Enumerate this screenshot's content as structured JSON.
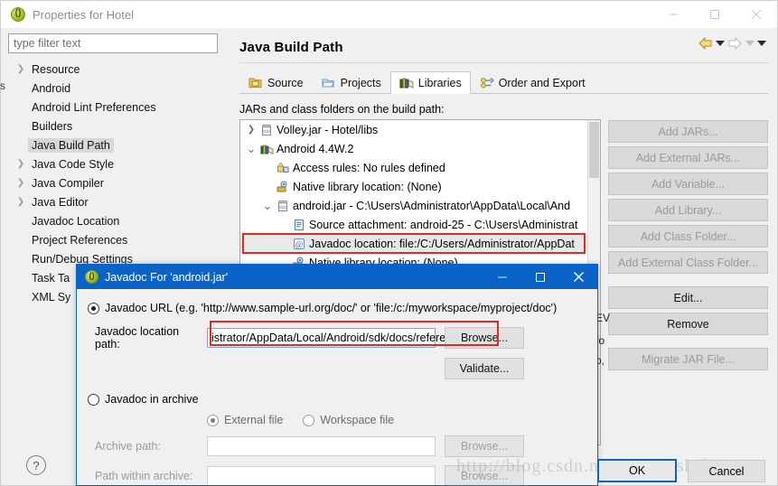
{
  "window": {
    "title": "Properties for Hotel",
    "icon": "eclipse-icon",
    "controls": {
      "minimize": "–",
      "maximize": "□",
      "close": "✕"
    }
  },
  "left_pane": {
    "filter": {
      "placeholder": "type filter text",
      "value": ""
    },
    "tree": [
      {
        "label": "Resource",
        "expandable": true,
        "selected": false
      },
      {
        "label": "Android",
        "expandable": false,
        "selected": false
      },
      {
        "label": "Android Lint Preferences",
        "expandable": false,
        "selected": false
      },
      {
        "label": "Builders",
        "expandable": false,
        "selected": false
      },
      {
        "label": "Java Build Path",
        "expandable": false,
        "selected": true
      },
      {
        "label": "Java Code Style",
        "expandable": true,
        "selected": false
      },
      {
        "label": "Java Compiler",
        "expandable": true,
        "selected": false
      },
      {
        "label": "Java Editor",
        "expandable": true,
        "selected": false
      },
      {
        "label": "Javadoc Location",
        "expandable": false,
        "selected": false
      },
      {
        "label": "Project References",
        "expandable": false,
        "selected": false
      },
      {
        "label": "Run/Debug Settings",
        "expandable": false,
        "selected": false
      },
      {
        "label": "Task Ta",
        "expandable": false,
        "selected": false
      },
      {
        "label": "XML Sy",
        "expandable": false,
        "selected": false
      }
    ],
    "edge_letter": "s"
  },
  "page": {
    "title": "Java Build Path",
    "nav": {
      "back": "back-arrow",
      "back_menu": "caret",
      "forward": "forward-arrow",
      "forward_menu": "caret",
      "view_menu": "caret"
    },
    "tabs": [
      {
        "label": "Source",
        "icon": "source-folder-icon",
        "active": false
      },
      {
        "label": "Projects",
        "icon": "projects-folder-icon",
        "active": false
      },
      {
        "label": "Libraries",
        "icon": "libraries-books-icon",
        "active": true
      },
      {
        "label": "Order and Export",
        "icon": "order-export-icon",
        "active": false
      }
    ],
    "jars_label": "JARs and class folders on the build path:",
    "tree": [
      {
        "label": "Volley.jar - Hotel/libs",
        "indent": 0,
        "twisty": "collapsed",
        "icon": "jar-icon",
        "selected": false
      },
      {
        "label": "Android 4.4W.2",
        "indent": 0,
        "twisty": "expanded",
        "icon": "library-icon",
        "selected": false
      },
      {
        "label": "Access rules: No rules defined",
        "indent": 1,
        "twisty": "",
        "icon": "access-rules-icon",
        "selected": false
      },
      {
        "label": "Native library location: (None)",
        "indent": 1,
        "twisty": "",
        "icon": "native-lib-icon",
        "selected": false
      },
      {
        "label": "android.jar - C:\\Users\\Administrator\\AppData\\Local\\And",
        "indent": 1,
        "twisty": "expanded",
        "icon": "jar-icon",
        "selected": false
      },
      {
        "label": "Source attachment: android-25 - C:\\Users\\Administrat",
        "indent": 2,
        "twisty": "",
        "icon": "source-attach-icon",
        "selected": false
      },
      {
        "label": "Javadoc location: file:/C:/Users/Administrator/AppDat",
        "indent": 2,
        "twisty": "",
        "icon": "javadoc-at-icon",
        "selected": false,
        "highlighted": true
      },
      {
        "label": "Native library location: (None)",
        "indent": 2,
        "twisty": "",
        "icon": "native-lib-icon",
        "selected": false
      },
      {
        "label": "",
        "indent": 2,
        "twisty": "",
        "icon": "access-rules-icon",
        "selected": true
      }
    ],
    "buttons": [
      {
        "label": "Add JARs...",
        "accesskey": "J",
        "enabled": false
      },
      {
        "label": "Add External JARs...",
        "accesskey": "x",
        "enabled": false
      },
      {
        "label": "Add Variable...",
        "accesskey": "V",
        "enabled": false
      },
      {
        "label": "Add Library...",
        "accesskey": "r",
        "enabled": false
      },
      {
        "label": "Add Class Folder...",
        "accesskey": "C",
        "enabled": false
      },
      {
        "label": "Add External Class Folder...",
        "accesskey": "d",
        "enabled": false
      },
      {
        "label": "Edit...",
        "accesskey": "E",
        "enabled": true
      },
      {
        "label": "Remove",
        "accesskey": "R",
        "enabled": true
      },
      {
        "label": "Migrate JAR File...",
        "accesskey": "M",
        "enabled": false
      }
    ],
    "hidden_fragments": [
      "EV",
      "fo",
      "o,"
    ],
    "help": "?"
  },
  "dialog": {
    "title": "Javadoc For 'android.jar'",
    "controls": {
      "minimize": "–",
      "maximize": "□",
      "close": "✕"
    },
    "javadoc_url": {
      "selected": true,
      "label": "Javadoc URL (e.g. 'http://www.sample-url.org/doc/' or 'file:/c:/myworkspace/myproject/doc')",
      "path_label": "Javadoc location path:",
      "path_value": "istrator/AppData/Local/Android/sdk/docs/reference",
      "browse": "Browse...",
      "validate": "Validate..."
    },
    "javadoc_archive": {
      "selected": false,
      "label": "Javadoc in archive",
      "external_file": "External file",
      "workspace_file": "Workspace file",
      "external_selected": true,
      "archive_path_label": "Archive path:",
      "archive_path_value": "",
      "archive_browse": "Browse...",
      "within_path_label": "Path within archive:",
      "within_path_value": "",
      "within_browse": "Browse..."
    }
  },
  "footer": {
    "ok": "OK",
    "cancel": "Cancel"
  },
  "watermark": "http://blog.csdn.net/ysc123shift",
  "colors": {
    "accent": "#0a64c8",
    "highlight_red": "#e02b24",
    "selection_gray": "#d8d8d8",
    "button_face": "#d9d9d9"
  }
}
